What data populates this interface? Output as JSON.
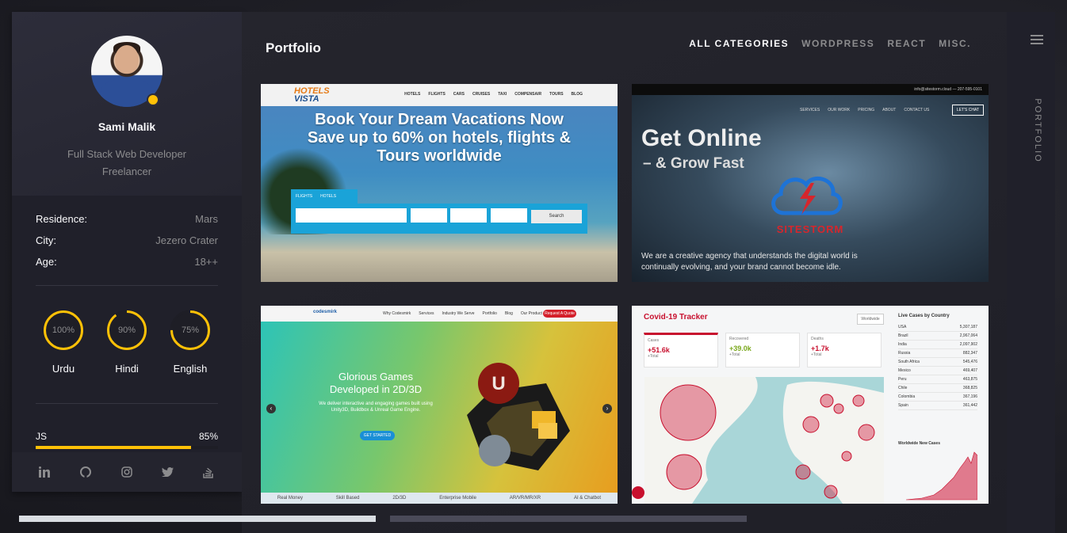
{
  "profile": {
    "name": "Sami Malik",
    "role_line1": "Full Stack Web Developer",
    "role_line2": "Freelancer",
    "status_color": "#ffc107"
  },
  "info": [
    {
      "label": "Residence:",
      "value": "Mars"
    },
    {
      "label": "City:",
      "value": "Jezero Crater"
    },
    {
      "label": "Age:",
      "value": "18++"
    }
  ],
  "languages": [
    {
      "name": "Urdu",
      "percent_label": "100%",
      "percent": 100
    },
    {
      "name": "Hindi",
      "percent_label": "90%",
      "percent": 90
    },
    {
      "name": "English",
      "percent_label": "75%",
      "percent": 75
    }
  ],
  "skills": [
    {
      "name": "JS",
      "percent_label": "85%",
      "percent": 85
    }
  ],
  "social": [
    "linkedin-icon",
    "github-icon",
    "instagram-icon",
    "twitter-icon",
    "stackoverflow-icon"
  ],
  "page": {
    "title": "Portfolio",
    "rail_label": "PORTFOLIO"
  },
  "filters": [
    "ALL CATEGORIES",
    "WORDPRESS",
    "REACT",
    "MISC."
  ],
  "accent": "#ffc107",
  "cards": {
    "hotels": {
      "logo_top": "HOTELS",
      "logo_bottom": "VISTA",
      "menu": [
        "HOTELS",
        "FLIGHTS",
        "CARS",
        "CRUISES",
        "TAXI",
        "COMPENSAIR",
        "TOURS",
        "BLOG"
      ],
      "hero_line1": "Book Your Dream Vacations Now",
      "hero_line2": "Save up to 60% on hotels, flights &",
      "hero_line3": "Tours worldwide",
      "tab_flights": "FLIGHTS",
      "tab_hotels": "HOTELS",
      "search": "Search"
    },
    "sitestorm": {
      "topbar": "info@sitestorm.cloud — 207-595-0101",
      "menu": [
        "SERVICES",
        "OUR WORK",
        "PRICING",
        "ABOUT",
        "CONTACT US"
      ],
      "chat": "LET'S CHAT",
      "h1": "Get Online",
      "h2": "– & Grow Fast",
      "brand": "SITESTORM",
      "tagline": "We are a creative agency that understands the digital world is continually evolving, and your brand cannot become idle."
    },
    "games": {
      "logo": "codesmirk",
      "menu": [
        "Why Codesmirk",
        "Services",
        "Industry We Serve",
        "Portfolio",
        "Blog",
        "Our Product"
      ],
      "quote": "Request A Quote",
      "heading_line1": "Glorious Games",
      "heading_line2": "Developed in 2D/3D",
      "para": "We deliver interactive and engaging games built using Unity3D, Buildbox & Unreal Game Engine.",
      "button": "GET STARTED",
      "footer": [
        "Real Money",
        "Skill Based",
        "2D/3D",
        "Enterprise Mobile",
        "AR/VR/MR/XR",
        "AI & Chatbot"
      ]
    },
    "covid": {
      "title": "Covid-19 Tracker",
      "select": "Worldwide",
      "stats": [
        {
          "label": "Cases",
          "value": "+51.6k",
          "total": "+Total"
        },
        {
          "label": "Recovered",
          "value": "+39.0k",
          "total": "+Total"
        },
        {
          "label": "Deaths",
          "value": "+1.7k",
          "total": "+Total"
        }
      ],
      "side_title": "Live Cases by Country",
      "countries": [
        {
          "name": "USA",
          "value": "5,307,187"
        },
        {
          "name": "Brazil",
          "value": "2,967,064"
        },
        {
          "name": "India",
          "value": "2,097,902"
        },
        {
          "name": "Russia",
          "value": "882,347"
        },
        {
          "name": "South Africa",
          "value": "545,476"
        },
        {
          "name": "Mexico",
          "value": "469,407"
        },
        {
          "name": "Peru",
          "value": "463,875"
        },
        {
          "name": "Chile",
          "value": "368,825"
        },
        {
          "name": "Colombia",
          "value": "367,196"
        },
        {
          "name": "Spain",
          "value": "361,442"
        }
      ],
      "wnc_title": "Worldwide New Cases"
    }
  }
}
